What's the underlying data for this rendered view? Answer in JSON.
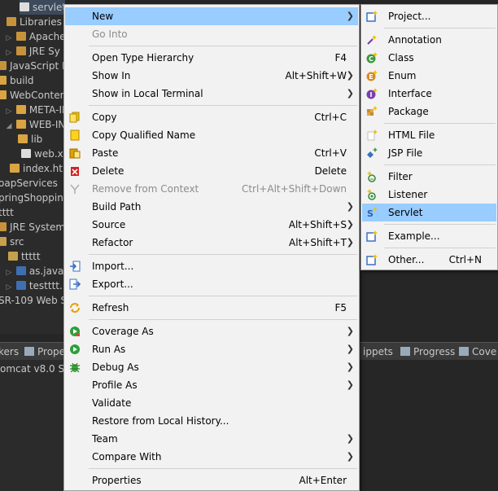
{
  "tree": {
    "items": [
      {
        "label": "servlet",
        "icon": "file-icon"
      },
      {
        "label": "Libraries",
        "icon": "library-icon"
      },
      {
        "label": "Apache",
        "icon": "library-icon"
      },
      {
        "label": "JRE Sy",
        "icon": "library-icon"
      },
      {
        "label": "JavaScript R",
        "icon": "library-icon"
      },
      {
        "label": "build",
        "icon": "folder-icon"
      },
      {
        "label": "WebContent",
        "icon": "folder-icon"
      },
      {
        "label": "META-IN",
        "icon": "folder-icon"
      },
      {
        "label": "WEB-INF",
        "icon": "folder-icon"
      },
      {
        "label": "lib",
        "icon": "folder-icon"
      },
      {
        "label": "web.xn",
        "icon": "xml-file-icon"
      },
      {
        "label": "index.htm",
        "icon": "html-file-icon"
      },
      {
        "label": "oapServices",
        "icon": "project-icon"
      },
      {
        "label": "pringShoppin",
        "icon": "project-icon"
      },
      {
        "label": "tttt",
        "icon": "project-icon"
      },
      {
        "label": "JRE System",
        "icon": "library-icon"
      },
      {
        "label": "src",
        "icon": "source-folder-icon"
      },
      {
        "label": "ttttt",
        "icon": "package-icon"
      },
      {
        "label": "as.java",
        "icon": "java-file-icon"
      },
      {
        "label": "testttt.",
        "icon": "java-file-icon"
      },
      {
        "label": "SR-109 Web S",
        "icon": "web-service-icon"
      }
    ]
  },
  "bottom_tabs": [
    {
      "label": "kers"
    },
    {
      "label": "Prope"
    },
    {
      "label": "ippets"
    },
    {
      "label": "Progress"
    },
    {
      "label": "Cove"
    }
  ],
  "server": {
    "label": "omcat v8.0 Se"
  },
  "menu": {
    "new": {
      "label": "New"
    },
    "go_into": {
      "label": "Go Into"
    },
    "open_type_hierarchy": {
      "label": "Open Type Hierarchy",
      "shortcut": "F4"
    },
    "show_in": {
      "label": "Show In",
      "shortcut": "Alt+Shift+W"
    },
    "show_in_terminal": {
      "label": "Show in Local Terminal"
    },
    "copy": {
      "label": "Copy",
      "shortcut": "Ctrl+C"
    },
    "copy_qualified": {
      "label": "Copy Qualified Name"
    },
    "paste": {
      "label": "Paste",
      "shortcut": "Ctrl+V"
    },
    "delete": {
      "label": "Delete",
      "shortcut": "Delete"
    },
    "remove_context": {
      "label": "Remove from Context",
      "shortcut": "Ctrl+Alt+Shift+Down"
    },
    "build_path": {
      "label": "Build Path"
    },
    "source": {
      "label": "Source",
      "shortcut": "Alt+Shift+S"
    },
    "refactor": {
      "label": "Refactor",
      "shortcut": "Alt+Shift+T"
    },
    "import": {
      "label": "Import..."
    },
    "export": {
      "label": "Export..."
    },
    "refresh": {
      "label": "Refresh",
      "shortcut": "F5"
    },
    "coverage_as": {
      "label": "Coverage As"
    },
    "run_as": {
      "label": "Run As"
    },
    "debug_as": {
      "label": "Debug As"
    },
    "profile_as": {
      "label": "Profile As"
    },
    "validate": {
      "label": "Validate"
    },
    "restore_history": {
      "label": "Restore from Local History..."
    },
    "team": {
      "label": "Team"
    },
    "compare_with": {
      "label": "Compare With"
    },
    "properties": {
      "label": "Properties",
      "shortcut": "Alt+Enter"
    }
  },
  "submenu": {
    "project": {
      "label": "Project..."
    },
    "annotation": {
      "label": "Annotation"
    },
    "class": {
      "label": "Class"
    },
    "enum": {
      "label": "Enum"
    },
    "interface": {
      "label": "Interface"
    },
    "package": {
      "label": "Package"
    },
    "html_file": {
      "label": "HTML File"
    },
    "jsp_file": {
      "label": "JSP File"
    },
    "filter": {
      "label": "Filter"
    },
    "listener": {
      "label": "Listener"
    },
    "servlet": {
      "label": "Servlet"
    },
    "example": {
      "label": "Example..."
    },
    "other": {
      "label": "Other...",
      "shortcut": "Ctrl+N"
    }
  },
  "colors": {
    "highlight": "#99ccff",
    "menu_bg": "#f2f2f2",
    "ide_bg": "#2b2b2b"
  }
}
